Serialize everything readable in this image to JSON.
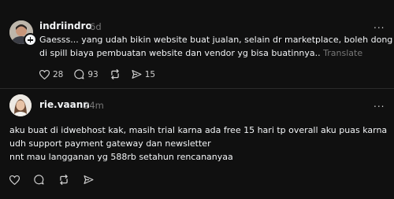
{
  "posts": [
    {
      "handle": "indriindro",
      "time": "6d",
      "more": "...",
      "text": "Gaesss... yang udah bikin website buat jualan, selain dr marketplace, boleh dong di spill biaya pembuatan website dan vendor yg bisa buatinnya..",
      "line1": "Gaesss... yang udah bikin website buat jualan, selain dr marketplace, boleh dong",
      "line2": "di spill biaya pembuatan website dan vendor yg bisa buatinnya..",
      "translate": "Translate",
      "likes": "28",
      "replies": "93",
      "shares": "15",
      "avatar_icon": "avatar-photo-man",
      "follow_icon": "plus-icon"
    },
    {
      "handle": "rie.vaann",
      "time": "24m",
      "more": "...",
      "line1": "aku buat di idwebhost kak, masih trial karna ada free 15 hari tp overall aku puas karna",
      "line2": "udh support payment gateway dan newsletter",
      "line3": "nnt mau langganan yg 588rb setahun rencananyaa",
      "avatar_icon": "avatar-photo-woman"
    }
  ],
  "colors": {
    "background": "#101010",
    "text": "#f3f5f7",
    "muted": "#777777",
    "divider": "#2a2a2a"
  }
}
